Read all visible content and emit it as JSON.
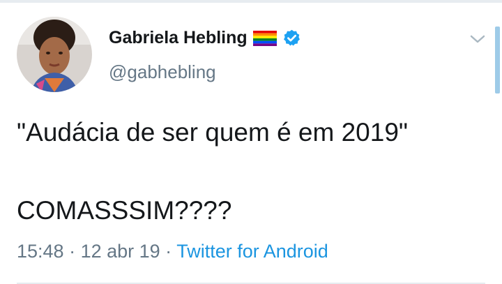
{
  "user": {
    "display_name": "Gabriela Hebling",
    "handle": "@gabhebling",
    "verified": true,
    "flag_icon": "rainbow-flag-icon",
    "verified_icon": "verified-badge-icon"
  },
  "tweet": {
    "line1": "\"Audácia de ser quem é em 2019\"",
    "line2": "COMASSSIM????"
  },
  "meta": {
    "time": "15:48",
    "separator": " · ",
    "date": "12 abr 19",
    "source": "Twitter for Android"
  },
  "colors": {
    "accent": "#1b95e0",
    "text": "#14171a",
    "muted": "#657786",
    "verified": "#1da1f2"
  }
}
